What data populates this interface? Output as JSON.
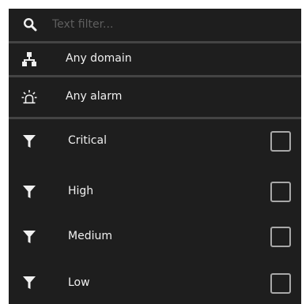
{
  "filter": {
    "placeholder": "Text filter...",
    "value": "",
    "icon": "search-icon"
  },
  "domain": {
    "label": "Any domain",
    "icon": "domain-hierarchy-icon"
  },
  "alarm": {
    "label": "Any alarm",
    "icon": "alarm-light-icon"
  },
  "severities": [
    {
      "label": "Critical",
      "checked": false,
      "icon": "filter-funnel-icon"
    },
    {
      "label": "High",
      "checked": false,
      "icon": "filter-funnel-icon"
    },
    {
      "label": "Medium",
      "checked": false,
      "icon": "filter-funnel-icon"
    },
    {
      "label": "Low",
      "checked": false,
      "icon": "filter-funnel-icon"
    }
  ],
  "colors": {
    "panel_background": "#1e1e1e",
    "separator": "#444444",
    "text": "#f0f0f0",
    "placeholder": "#5f5f5f",
    "checkbox_border": "#a8a8a8"
  }
}
